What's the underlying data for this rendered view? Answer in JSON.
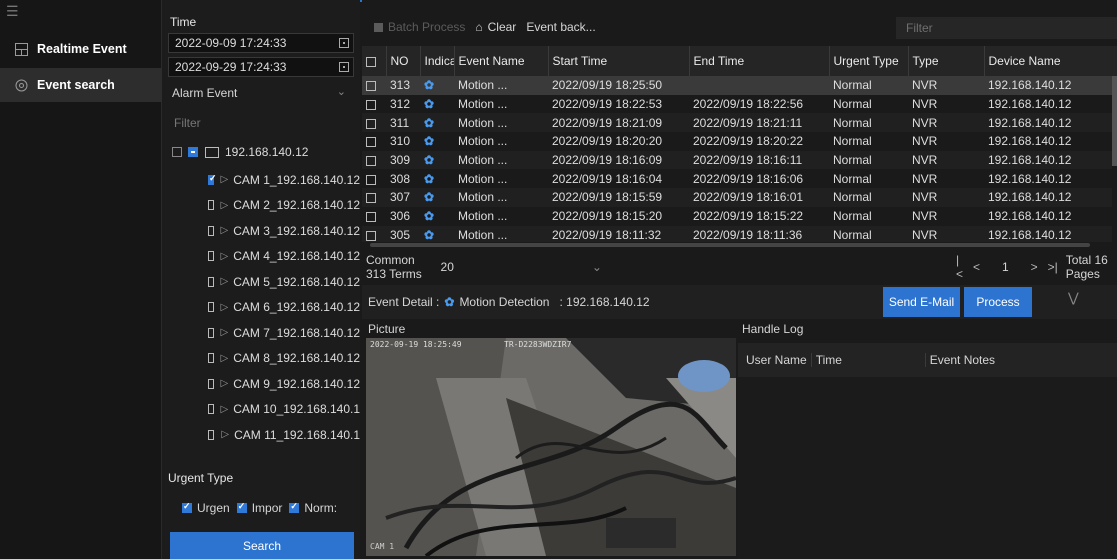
{
  "sidebar": {
    "items": [
      {
        "label": "Realtime Event",
        "icon": "realtime-icon"
      },
      {
        "label": "Event search",
        "icon": "gear-icon"
      }
    ]
  },
  "filters": {
    "time_label": "Time",
    "start": "2022-09-09 17:24:33",
    "end": "2022-09-29 17:24:33",
    "event_type": "Alarm Event",
    "filter_placeholder": "Filter",
    "device": "192.168.140.12",
    "cameras": [
      "CAM 1_192.168.140.12",
      "CAM 2_192.168.140.12",
      "CAM 3_192.168.140.12",
      "CAM 4_192.168.140.12",
      "CAM 5_192.168.140.12",
      "CAM 6_192.168.140.12",
      "CAM 7_192.168.140.12",
      "CAM 8_192.168.140.12",
      "CAM 9_192.168.140.12",
      "CAM 10_192.168.140.1",
      "CAM 11_192.168.140.1"
    ],
    "urgent_label": "Urgent Type",
    "urgent_options": [
      "Urgen",
      "Impor",
      "Norm:"
    ],
    "search_label": "Search"
  },
  "toolbar": {
    "batch": "Batch Process",
    "clear": "Clear",
    "event_back": "Event back...",
    "filter_placeholder": "Filter"
  },
  "table": {
    "headers": [
      "NO",
      "Indicat",
      "Event Name",
      "Start Time",
      "End Time",
      "Urgent Type",
      "Type",
      "Device Name"
    ],
    "rows": [
      {
        "no": "313",
        "name": "Motion ...",
        "start": "2022/09/19 18:25:50",
        "end": "",
        "urgent": "Normal",
        "type": "NVR",
        "device": "192.168.140.12"
      },
      {
        "no": "312",
        "name": "Motion ...",
        "start": "2022/09/19 18:22:53",
        "end": "2022/09/19 18:22:56",
        "urgent": "Normal",
        "type": "NVR",
        "device": "192.168.140.12"
      },
      {
        "no": "311",
        "name": "Motion ...",
        "start": "2022/09/19 18:21:09",
        "end": "2022/09/19 18:21:11",
        "urgent": "Normal",
        "type": "NVR",
        "device": "192.168.140.12"
      },
      {
        "no": "310",
        "name": "Motion ...",
        "start": "2022/09/19 18:20:20",
        "end": "2022/09/19 18:20:22",
        "urgent": "Normal",
        "type": "NVR",
        "device": "192.168.140.12"
      },
      {
        "no": "309",
        "name": "Motion ...",
        "start": "2022/09/19 18:16:09",
        "end": "2022/09/19 18:16:11",
        "urgent": "Normal",
        "type": "NVR",
        "device": "192.168.140.12"
      },
      {
        "no": "308",
        "name": "Motion ...",
        "start": "2022/09/19 18:16:04",
        "end": "2022/09/19 18:16:06",
        "urgent": "Normal",
        "type": "NVR",
        "device": "192.168.140.12"
      },
      {
        "no": "307",
        "name": "Motion ...",
        "start": "2022/09/19 18:15:59",
        "end": "2022/09/19 18:16:01",
        "urgent": "Normal",
        "type": "NVR",
        "device": "192.168.140.12"
      },
      {
        "no": "306",
        "name": "Motion ...",
        "start": "2022/09/19 18:15:20",
        "end": "2022/09/19 18:15:22",
        "urgent": "Normal",
        "type": "NVR",
        "device": "192.168.140.12"
      },
      {
        "no": "305",
        "name": "Motion ...",
        "start": "2022/09/19 18:11:32",
        "end": "2022/09/19 18:11:36",
        "urgent": "Normal",
        "type": "NVR",
        "device": "192.168.140.12"
      }
    ]
  },
  "pager": {
    "summary": "Common 313 Terms",
    "page_size": "20",
    "current": "1",
    "total": "Total 16 Pages"
  },
  "detail": {
    "prefix": "Event Detail :",
    "event": "Motion Detection",
    "device": ": 192.168.140.12",
    "send_email": "Send E-Mail",
    "process": "Process",
    "picture_label": "Picture",
    "overlay_time": "2022-09-19 18:25:49",
    "overlay_model": "TR-D2283WDZIR7",
    "overlay_cam": "CAM 1",
    "handle_log_label": "Handle Log",
    "log_headers": [
      "User Name",
      "Time",
      "Event Notes"
    ]
  },
  "colors": {
    "accent": "#2d74d1",
    "indicator": "#4a9bf0"
  }
}
